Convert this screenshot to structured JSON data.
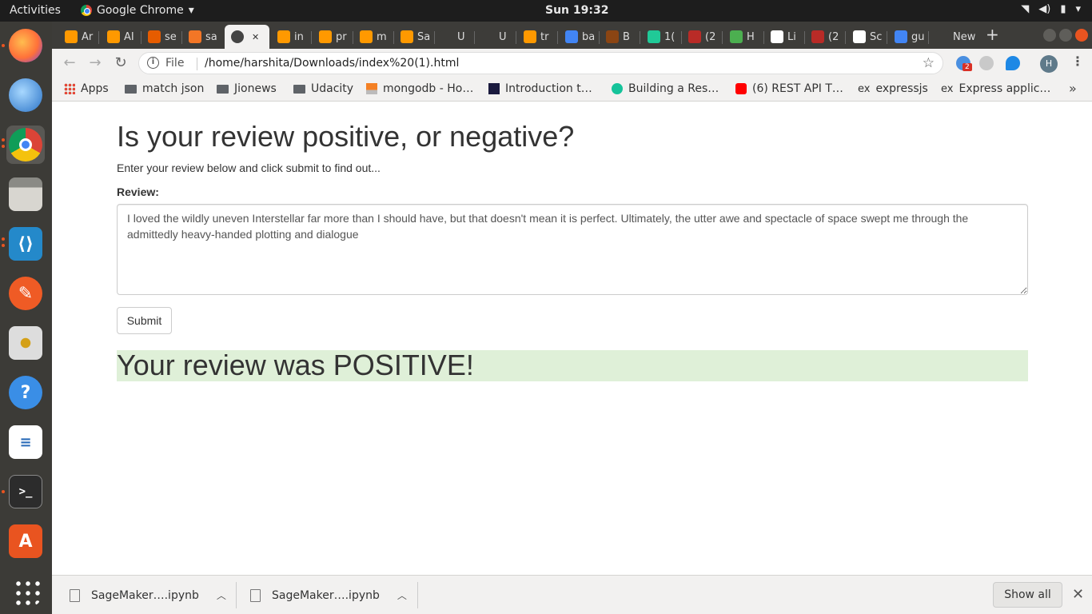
{
  "system": {
    "activities": "Activities",
    "app_name": "Google Chrome",
    "clock": "Sun 19:32"
  },
  "tabs": [
    {
      "label": "Ar",
      "color": "#ff9900"
    },
    {
      "label": "AI",
      "color": "#ff9900"
    },
    {
      "label": "se",
      "color": "#e65c00"
    },
    {
      "label": "sa",
      "color": "#f37626"
    },
    {
      "label": "",
      "color": "#444444",
      "active": true
    },
    {
      "label": "in",
      "color": "#ff9900"
    },
    {
      "label": "pr",
      "color": "#ff9900"
    },
    {
      "label": "m",
      "color": "#ff9900"
    },
    {
      "label": "Sa",
      "color": "#ff9900"
    },
    {
      "label": "U",
      "color": "#3d3c39"
    },
    {
      "label": "U",
      "color": "#3d3c39"
    },
    {
      "label": "tr",
      "color": "#ff9900"
    },
    {
      "label": "ba",
      "color": "#4285f4"
    },
    {
      "label": "B",
      "color": "#8b4513"
    },
    {
      "label": "1(",
      "color": "#20c997"
    },
    {
      "label": "(2",
      "color": "#b92b27"
    },
    {
      "label": "H",
      "color": "#4caf50"
    },
    {
      "label": "Li",
      "color": "#ffffff"
    },
    {
      "label": "(2",
      "color": "#b92b27"
    },
    {
      "label": "Sc",
      "color": "#ffffff"
    },
    {
      "label": "gu",
      "color": "#4285f4"
    },
    {
      "label": "New",
      "color": "#3d3c39"
    }
  ],
  "omnibox": {
    "scheme_label": "File",
    "url": "/home/harshita/Downloads/index%20(1).html"
  },
  "profile": {
    "initial": "H"
  },
  "extensions": {
    "badge": "2"
  },
  "bookmarks": [
    {
      "label": "Apps",
      "icon": "apps-grid-icon"
    },
    {
      "label": "match json",
      "icon": "folder-icon"
    },
    {
      "label": "Jionews",
      "icon": "folder-icon"
    },
    {
      "label": "Udacity",
      "icon": "folder-icon"
    },
    {
      "label": "mongodb - Ho…",
      "icon": "stackoverflow-icon"
    },
    {
      "label": "Introduction t…",
      "icon": "site-icon"
    },
    {
      "label": "Building a Res…",
      "icon": "grammarly-icon"
    },
    {
      "label": "(6) REST API T…",
      "icon": "youtube-icon"
    },
    {
      "label": "expressjs",
      "icon": "ex-icon"
    },
    {
      "label": "Express applic…",
      "icon": "ex-icon"
    }
  ],
  "page": {
    "heading": "Is your review positive, or negative?",
    "intro": "Enter your review below and click submit to find out...",
    "review_label": "Review:",
    "review_text": "I loved the wildly uneven Interstellar far more than I should have, but that doesn't mean it is perfect. Ultimately, the utter awe and spectacle of space swept me through the admittedly heavy-handed plotting and dialogue",
    "submit_label": "Submit",
    "result": "Your review was POSITIVE!"
  },
  "downloads": {
    "items": [
      {
        "name": "SageMaker….ipynb"
      },
      {
        "name": "SageMaker….ipynb"
      }
    ],
    "show_all": "Show all"
  },
  "colors": {
    "result_bg": "#dff0d8",
    "ubuntu_orange": "#e95420"
  }
}
